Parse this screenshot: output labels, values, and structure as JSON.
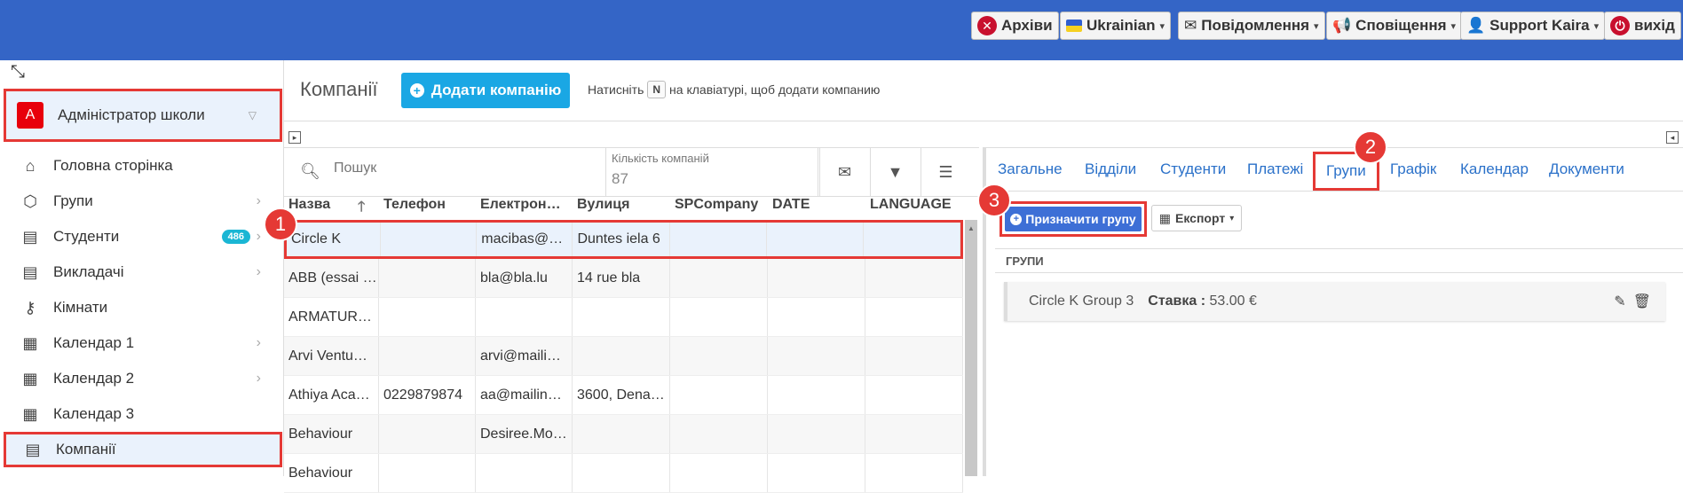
{
  "topbar": {
    "archives": "Архіви",
    "language": "Ukrainian",
    "messages": "Повідомлення",
    "notifications": "Сповіщення",
    "user": "Support Kaira",
    "logout": "вихід"
  },
  "sidebar": {
    "school": {
      "badge": "A",
      "label": "Адміністратор школи"
    },
    "items": [
      {
        "label": "Головна сторінка",
        "icon": "home-icon"
      },
      {
        "label": "Групи",
        "icon": "cube-icon"
      },
      {
        "label": "Студенти",
        "icon": "id-card-icon",
        "count": "486"
      },
      {
        "label": "Викладачі",
        "icon": "id-card-icon"
      },
      {
        "label": "Кімнати",
        "icon": "key-icon"
      },
      {
        "label": "Календар 1",
        "icon": "calendar-icon"
      },
      {
        "label": "Календар 2",
        "icon": "calendar-icon"
      },
      {
        "label": "Календар 3",
        "icon": "calendar-icon"
      },
      {
        "label": "Компанії",
        "icon": "id-card-icon"
      }
    ]
  },
  "header": {
    "title": "Компанії",
    "add_button": "Додати компанію",
    "hint_prefix": "Натисніть",
    "hint_key": "N",
    "hint_suffix": "на клавіатурі, щоб додати компанию"
  },
  "list": {
    "search_placeholder": "Пошук",
    "count_label": "Кількість компаній",
    "count_value": "87",
    "columns": [
      "Назва",
      "Телефон",
      "Електрон…",
      "Вулиця",
      "SPCompany",
      "DATE",
      "LANGUAGE"
    ],
    "rows": [
      [
        "Circle K",
        "",
        "macibas@…",
        "Duntes iela 6",
        "",
        "",
        ""
      ],
      [
        "ABB (essai …",
        "",
        "bla@bla.lu",
        "14 rue bla",
        "",
        "",
        ""
      ],
      [
        "ARMATUR…",
        "",
        "",
        "",
        "",
        "",
        ""
      ],
      [
        "Arvi Ventu…",
        "",
        "arvi@maili…",
        "",
        "",
        "",
        ""
      ],
      [
        "Athiya Aca…",
        "0229879874",
        "aa@mailin…",
        "3600, Dena…",
        "",
        "",
        ""
      ],
      [
        "Behaviour",
        "",
        "Desiree.Mo…",
        "",
        "",
        "",
        ""
      ],
      [
        "Behaviour",
        "",
        "",
        "",
        "",
        "",
        ""
      ]
    ]
  },
  "detail": {
    "tabs": [
      "Загальне",
      "Відділи",
      "Студенти",
      "Платежі",
      "Групи",
      "Графік",
      "Календар",
      "Документи"
    ],
    "active_tab": "Групи",
    "assign_button": "Призначити групу",
    "export_button": "Експорт",
    "groups_header": "ГРУПИ",
    "group": {
      "name": "Circle K Group 3",
      "rate_label": "Ставка :",
      "rate_value": "53.00 €"
    }
  },
  "markers": [
    "1",
    "2",
    "3"
  ],
  "colors": {
    "topbar": "#3465c6",
    "highlight": "#e53935",
    "accent": "#1aa7e4"
  }
}
